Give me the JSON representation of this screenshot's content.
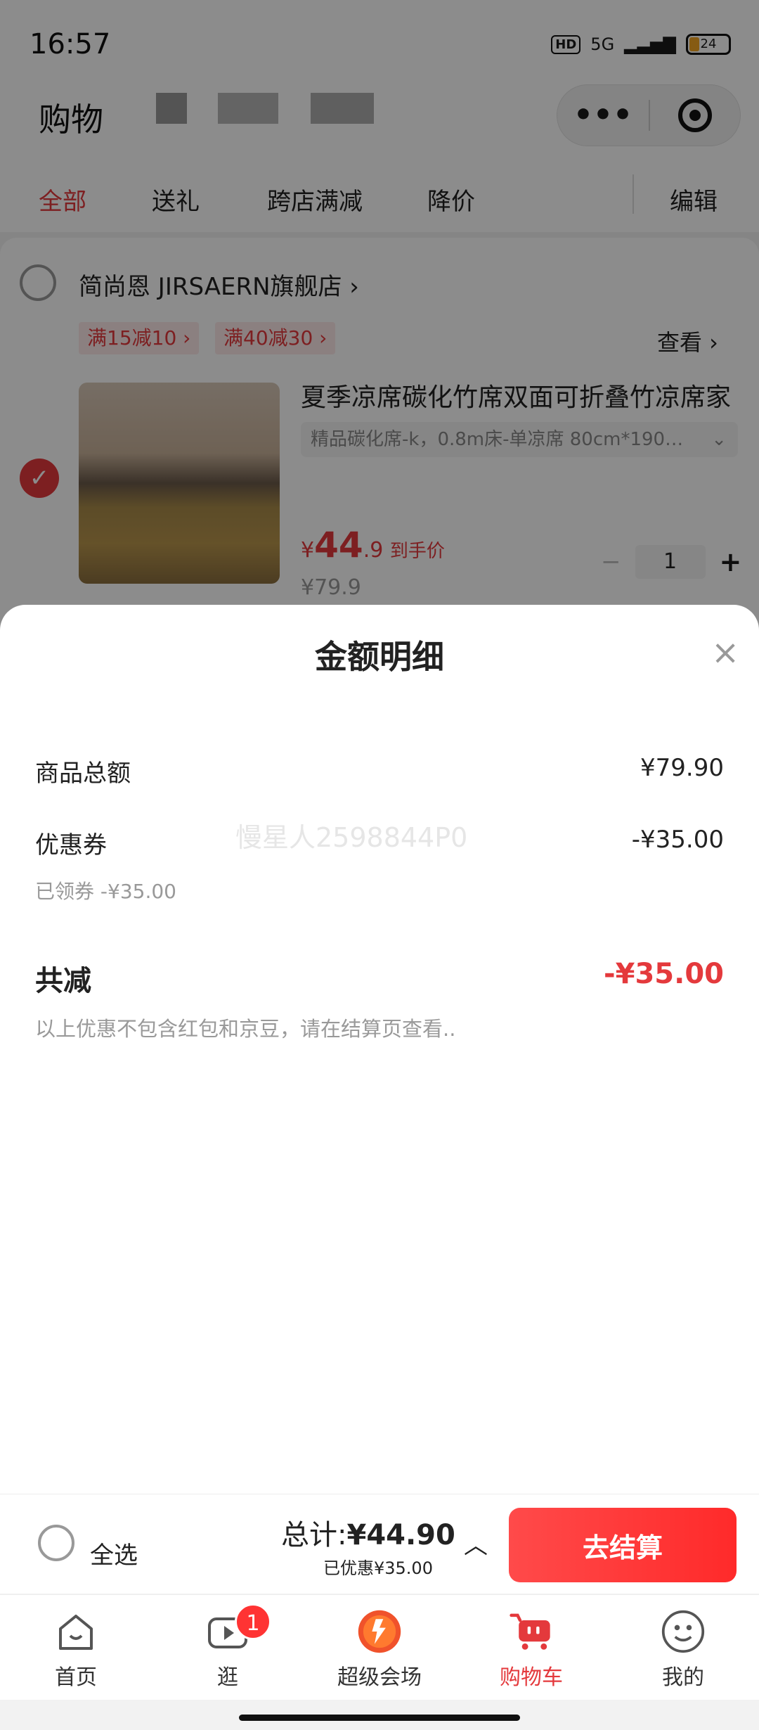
{
  "status_bar": {
    "time": "16:57",
    "hd": "HD",
    "network": "5G",
    "battery": "24"
  },
  "header": {
    "title": "购物",
    "menu_icon": "more-dots-icon",
    "capsule_icon": "target-icon"
  },
  "tabs": [
    {
      "label": "全部",
      "active": true
    },
    {
      "label": "送礼",
      "active": false
    },
    {
      "label": "跨店满减",
      "active": false
    },
    {
      "label": "降价",
      "active": false
    },
    {
      "label": "编辑",
      "active": false
    }
  ],
  "store": {
    "name": "简尚恩 JIRSAERN旗舰店 ›",
    "promos": [
      "满15减10 ›",
      "满40减30 ›"
    ],
    "view_label": "查看 ›"
  },
  "product": {
    "title": "夏季凉席碳化竹席双面可折叠竹凉席家",
    "sku": "精品碳化席-k，0.8m床-单凉席 80cm*190…",
    "currency": "¥",
    "price_int": "44",
    "price_dec": ".9",
    "price_tag": "到手价",
    "original_price": "¥79.9",
    "quantity": "1",
    "minus": "−",
    "plus": "+"
  },
  "sheet": {
    "title": "金额明细",
    "close": "×",
    "goods_total_label": "商品总额",
    "goods_total_value": "¥79.90",
    "coupon_label": "优惠券",
    "coupon_value": "-¥35.00",
    "coupon_sub": "已领券 -¥35.00",
    "watermark": "慢星人2598844P0",
    "total_reduce_label": "共减",
    "total_reduce_value": "-¥35.00",
    "note": "以上优惠不包含红包和京豆，请在结算页查看.."
  },
  "bottom_bar": {
    "select_all": "全选",
    "total_label": "总计:",
    "total_value": "¥44.90",
    "saved": "已优惠¥35.00",
    "chevron": "︿",
    "checkout": "去结算"
  },
  "nav": [
    {
      "label": "首页",
      "icon": "home-icon"
    },
    {
      "label": "逛",
      "icon": "play-icon",
      "badge": "1"
    },
    {
      "label": "超级会场",
      "icon": "venue-icon"
    },
    {
      "label": "购物车",
      "icon": "cart-icon",
      "active": true
    },
    {
      "label": "我的",
      "icon": "profile-icon"
    }
  ],
  "colors": {
    "accent": "#e4393c",
    "checkout": "#ff3333"
  }
}
